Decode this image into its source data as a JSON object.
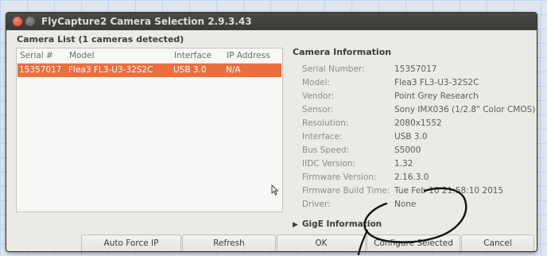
{
  "window": {
    "title": "FlyCapture2 Camera Selection 2.9.3.43"
  },
  "camera_list": {
    "title": "Camera List  (1 cameras detected)",
    "columns": [
      "Serial #",
      "Model",
      "Interface",
      "IP Address"
    ],
    "rows": [
      {
        "serial": "15357017",
        "model": "Flea3 FL3-U3-32S2C",
        "interface": "USB 3.0",
        "ip": "N/A",
        "selected": true
      }
    ]
  },
  "camera_info": {
    "title": "Camera Information",
    "fields": [
      {
        "label": "Serial Number:",
        "value": "15357017"
      },
      {
        "label": "Model:",
        "value": "Flea3 FL3-U3-32S2C"
      },
      {
        "label": "Vendor:",
        "value": "Point Grey Research"
      },
      {
        "label": "Sensor:",
        "value": "Sony IMX036 (1/2.8\" Color CMOS)"
      },
      {
        "label": "Resolution:",
        "value": "2080x1552"
      },
      {
        "label": "Interface:",
        "value": "USB 3.0"
      },
      {
        "label": "Bus Speed:",
        "value": "S5000"
      },
      {
        "label": "IIDC Version:",
        "value": "1.32"
      },
      {
        "label": "Firmware Version:",
        "value": "2.16.3.0"
      },
      {
        "label": "Firmware Build Time:",
        "value": "Tue Feb 10 21:58:10 2015"
      },
      {
        "label": "Driver:",
        "value": "None"
      }
    ],
    "gige_label": "GigE Information"
  },
  "buttons": {
    "auto_force_ip": "Auto Force IP",
    "refresh": "Refresh",
    "ok": "OK",
    "configure_selected": "Configure Selected",
    "cancel": "Cancel"
  },
  "colors": {
    "selection": "#ea6f3f",
    "titlebar": "#3d3d3a",
    "window_bg": "#ebeae6",
    "close_button": "#e8562e",
    "annotation_ink": "#111111"
  }
}
